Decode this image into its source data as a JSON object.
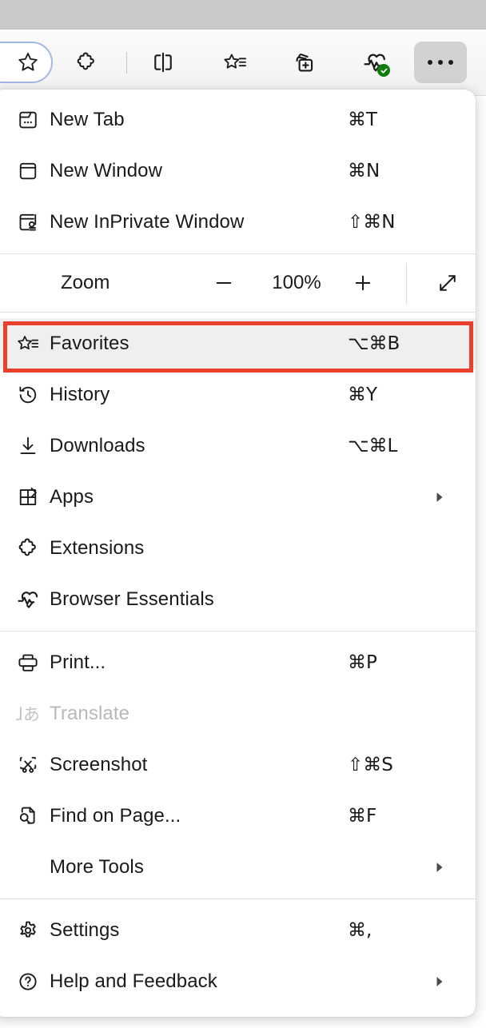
{
  "toolbar": {
    "buttons": [
      {
        "name": "favorites-star-icon",
        "label": "Add this page to favorites",
        "focused": true
      },
      {
        "name": "extensions-icon",
        "label": "Extensions"
      },
      {
        "name": "split-screen-icon",
        "label": "Split screen"
      },
      {
        "name": "favorites-bar-icon",
        "label": "Favorites"
      },
      {
        "name": "collections-icon",
        "label": "Collections"
      },
      {
        "name": "browser-essentials-icon",
        "label": "Browser essentials",
        "badge": "check"
      },
      {
        "name": "more-options-icon",
        "label": "Settings and more",
        "pressed": true
      }
    ],
    "badge_color": "#107c10",
    "pressed_bg": "#d2d2d2",
    "focus_ring_color": "#a5b6e8"
  },
  "menu": {
    "highlight_color": "#e8402a",
    "highlight_target": "Favorites",
    "sections": [
      {
        "items": [
          {
            "icon": "new-tab-icon",
            "label": "New Tab",
            "shortcut": "⌘T"
          },
          {
            "icon": "new-window-icon",
            "label": "New Window",
            "shortcut": "⌘N"
          },
          {
            "icon": "inprivate-window-icon",
            "label": "New InPrivate Window",
            "shortcut": "⇧⌘N"
          }
        ]
      },
      {
        "zoom_row": {
          "label": "Zoom",
          "minus": "−",
          "value": "100%",
          "plus": "+",
          "fullscreen_icon": "fullscreen-icon"
        }
      },
      {
        "items": [
          {
            "icon": "favorites-icon",
            "label": "Favorites",
            "shortcut": "⌥⌘B",
            "highlighted": true
          },
          {
            "icon": "history-icon",
            "label": "History",
            "shortcut": "⌘Y"
          },
          {
            "icon": "downloads-icon",
            "label": "Downloads",
            "shortcut": "⌥⌘L"
          },
          {
            "icon": "apps-icon",
            "label": "Apps",
            "submenu": true
          },
          {
            "icon": "extensions-icon",
            "label": "Extensions"
          },
          {
            "icon": "browser-essentials-icon",
            "label": "Browser Essentials"
          }
        ]
      },
      {
        "items": [
          {
            "icon": "print-icon",
            "label": "Print...",
            "shortcut": "⌘P"
          },
          {
            "icon": "translate-icon",
            "label": "Translate",
            "disabled": true
          },
          {
            "icon": "screenshot-icon",
            "label": "Screenshot",
            "shortcut": "⇧⌘S"
          },
          {
            "icon": "find-on-page-icon",
            "label": "Find on Page...",
            "shortcut": "⌘F"
          },
          {
            "icon": "none",
            "label": "More Tools",
            "submenu": true
          }
        ]
      },
      {
        "items": [
          {
            "icon": "settings-gear-icon",
            "label": "Settings",
            "shortcut": "⌘,"
          },
          {
            "icon": "help-feedback-icon",
            "label": "Help and Feedback",
            "submenu": true
          }
        ]
      }
    ]
  }
}
